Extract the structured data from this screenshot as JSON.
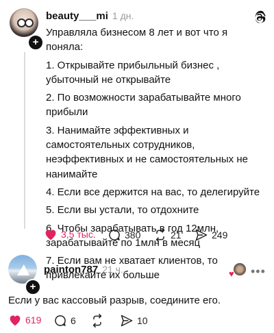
{
  "post1": {
    "username": "beauty___mi",
    "time": "1 дн.",
    "lines": [
      "Управляла бизнесом 8 лет и вот что я поняла:",
      "1. Открывайте прибыльный бизнес , убыточный не открывайте",
      "2. По возможности зарабатывайте много прибыли",
      "3. Нанимайте эффективных и самостоятельных сотрудников, неэффективных и не самостоятельных не нанимайте",
      "4. Если все держится на вас, то делегируйте",
      "5. Если вы устали, то отдохните",
      "6. Чтобы зарабатывать в год 12млн, зарабатывайте по 1млн в месяц",
      "7. Если вам не хватает клиентов, то привлекайте их больше"
    ],
    "likes": "3,5 тыс.",
    "comments": "380",
    "reposts": "21",
    "shares": "249"
  },
  "post2": {
    "username": "painton787",
    "time": "21 ч.",
    "text": "Если у вас кассовый разрыв, соедините его.",
    "likes": "619",
    "comments": "6",
    "shares": "10"
  },
  "colors": {
    "like": "#e0245e",
    "muted": "#999999",
    "line": "#dcdcdc"
  },
  "icons": [
    "threads-logo-icon",
    "heart-icon",
    "comment-icon",
    "repost-icon",
    "share-icon",
    "plus-icon",
    "more-icon"
  ]
}
